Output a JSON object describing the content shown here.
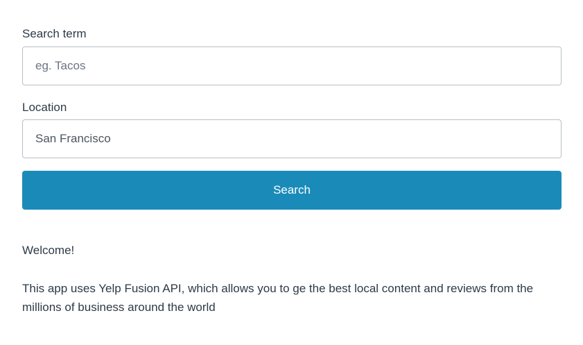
{
  "form": {
    "term_label": "Search term",
    "term_value": "",
    "term_placeholder": "eg. Tacos",
    "location_label": "Location",
    "location_value": "San Francisco",
    "location_placeholder": "",
    "search_label": "Search"
  },
  "content": {
    "welcome": "Welcome!",
    "description": "This app uses Yelp Fusion API, which allows you to ge the best local content and reviews from the millions of business around the world"
  },
  "colors": {
    "primary_button": "#1a8bb9",
    "text": "#2d3a46",
    "input_border": "#b9bec4"
  }
}
